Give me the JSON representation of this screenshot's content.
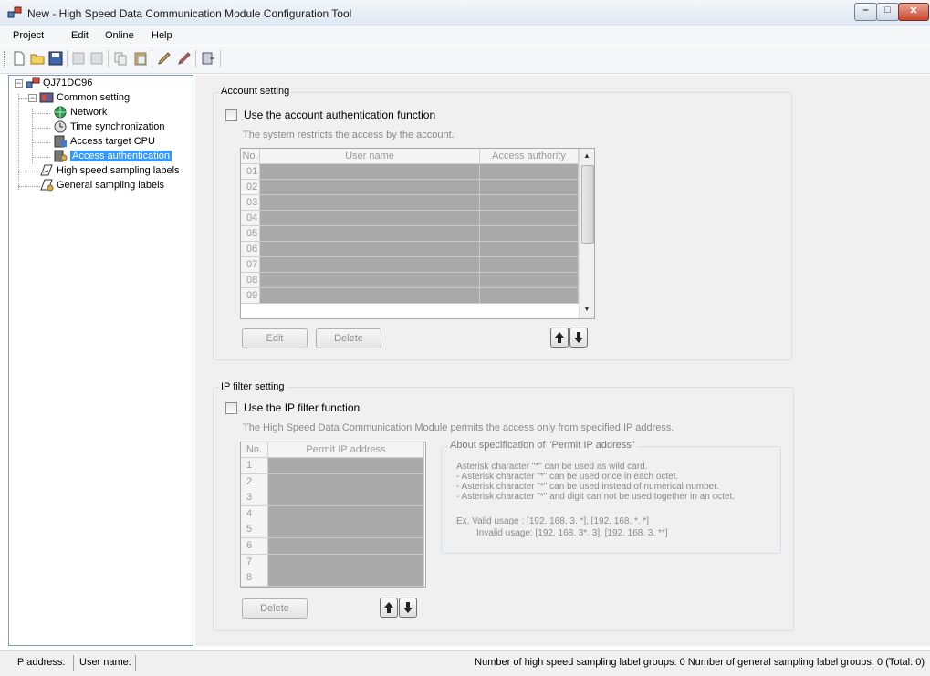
{
  "window": {
    "title": "New - High Speed Data Communication Module Configuration Tool",
    "controls": {
      "minimize": "–",
      "maximize": "□",
      "close": "✕"
    }
  },
  "menu": [
    {
      "label": "Project"
    },
    {
      "label": "Edit"
    },
    {
      "label": "Online"
    },
    {
      "label": "Help"
    }
  ],
  "toolbar": {
    "icons": [
      "new-file-icon",
      "open-folder-icon",
      "save-icon",
      "add-group-icon",
      "remove-group-icon",
      "copy-icon",
      "paste-icon",
      "edit-tool-icon",
      "edit-tool-2-icon",
      "settings-transfer-icon"
    ]
  },
  "tree": {
    "root": "QJ71DC96",
    "common": "Common setting",
    "network": "Network",
    "time_sync": "Time synchronization",
    "access_cpu": "Access target CPU",
    "access_auth": "Access authentication",
    "high_speed": "High speed sampling labels",
    "general": "General sampling labels",
    "selected": "Access authentication"
  },
  "account": {
    "group_title": "Account setting",
    "checkbox_label": "Use the account authentication function",
    "checked": false,
    "description": "The system restricts the access by the account.",
    "columns": {
      "no": "No.",
      "user": "User name",
      "authority": "Access authority"
    },
    "rows": [
      "01",
      "02",
      "03",
      "04",
      "05",
      "06",
      "07",
      "08",
      "09"
    ],
    "edit_label": "Edit",
    "delete_label": "Delete"
  },
  "ipfilter": {
    "group_title": "IP filter setting",
    "checkbox_label": "Use the IP filter function",
    "checked": false,
    "description": "The High Speed Data Communication Module permits the access only from specified IP address.",
    "columns": {
      "no": "No.",
      "address": "Permit IP address"
    },
    "rows": [
      "1",
      "2",
      "3",
      "4",
      "5",
      "6",
      "7",
      "8"
    ],
    "delete_label": "Delete",
    "about": {
      "title": "About specification of \"Permit IP address\"",
      "l1": "Asterisk character \"*\" can be used as wild card.",
      "l2": "- Asterisk character \"*\" can be used once in each octet.",
      "l3": "- Asterisk character \"*\" can be used instead of numerical number.",
      "l4": "- Asterisk character \"*\" and digit can not be used together in an octet.",
      "l5": "Ex. Valid usage  : [192. 168. 3. *], [192. 168. *. *]",
      "l6": "Invalid usage: [192. 168. 3*. 3], [192. 168. 3. **]"
    }
  },
  "status": {
    "ip": "IP address:",
    "user": "User name:",
    "counts": "Number of high speed sampling label groups: 0   Number of general sampling label groups: 0   (Total: 0)"
  }
}
